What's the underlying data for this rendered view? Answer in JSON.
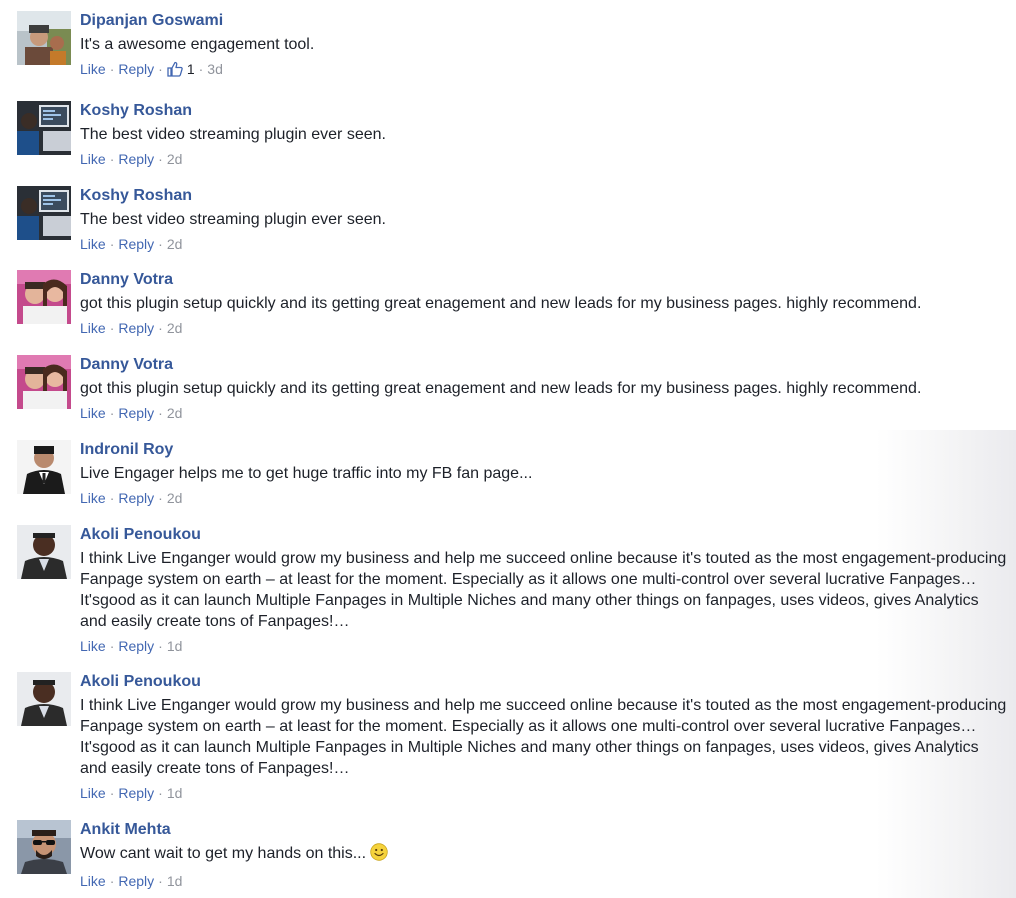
{
  "comments": [
    {
      "author": "Dipanjan Goswami",
      "text": "It's a awesome engagement tool.",
      "like": "Like",
      "reply": "Reply",
      "like_count": "1",
      "time": "3d",
      "avatar_icon": "user-avatar-outdoor"
    },
    {
      "author": "Koshy Roshan",
      "text": "The best video streaming plugin ever seen.",
      "like": "Like",
      "reply": "Reply",
      "time": "2d",
      "avatar_icon": "user-avatar-computer"
    },
    {
      "author": "Koshy Roshan",
      "text": "The best video streaming plugin ever seen.",
      "like": "Like",
      "reply": "Reply",
      "time": "2d",
      "avatar_icon": "user-avatar-computer"
    },
    {
      "author": "Danny Votra",
      "text": "got this plugin setup quickly and its getting great enagement and new leads for my business pages. highly recommend.",
      "like": "Like",
      "reply": "Reply",
      "time": "2d",
      "avatar_icon": "user-avatar-couple"
    },
    {
      "author": "Danny Votra",
      "text": "got this plugin setup quickly and its getting great enagement and new leads for my business pages. highly recommend.",
      "like": "Like",
      "reply": "Reply",
      "time": "2d",
      "avatar_icon": "user-avatar-couple"
    },
    {
      "author": "Indronil Roy",
      "text": "Live Engager helps me to get huge traffic into my FB fan page...",
      "like": "Like",
      "reply": "Reply",
      "time": "2d",
      "avatar_icon": "user-avatar-suit"
    },
    {
      "author": "Akoli Penoukou",
      "text": "I think Live Enganger would grow my business and help me succeed online because it's touted as the most engagement-producing Fanpage system on earth – at least for the moment. Especially as it allows one multi-control over several lucrative Fanpages… It'sgood as it can launch Multiple Fanpages in Multiple Niches and many other things on fanpages, uses videos, gives Analytics and easily create tons of Fanpages!…",
      "like": "Like",
      "reply": "Reply",
      "time": "1d",
      "avatar_icon": "user-avatar-portrait"
    },
    {
      "author": "Akoli Penoukou",
      "text": "I think Live Enganger would grow my business and help me succeed online because it's touted as the most engagement-producing Fanpage system on earth – at least for the moment. Especially as it allows one multi-control over several lucrative Fanpages… It'sgood as it can launch Multiple Fanpages in Multiple Niches and many other things on fanpages, uses videos, gives Analytics and easily create tons of Fanpages!…",
      "like": "Like",
      "reply": "Reply",
      "time": "1d",
      "avatar_icon": "user-avatar-portrait"
    },
    {
      "author": "Ankit Mehta",
      "text": "Wow cant wait to get my hands on this...",
      "like": "Like",
      "reply": "Reply",
      "time": "1d",
      "avatar_icon": "user-avatar-sunglasses",
      "emoji": "smiley-emoji"
    }
  ],
  "colors": {
    "author": "#365899",
    "link": "#4267b2",
    "text": "#1d2129",
    "meta": "#90949c",
    "like_icon": "#4267b2"
  }
}
